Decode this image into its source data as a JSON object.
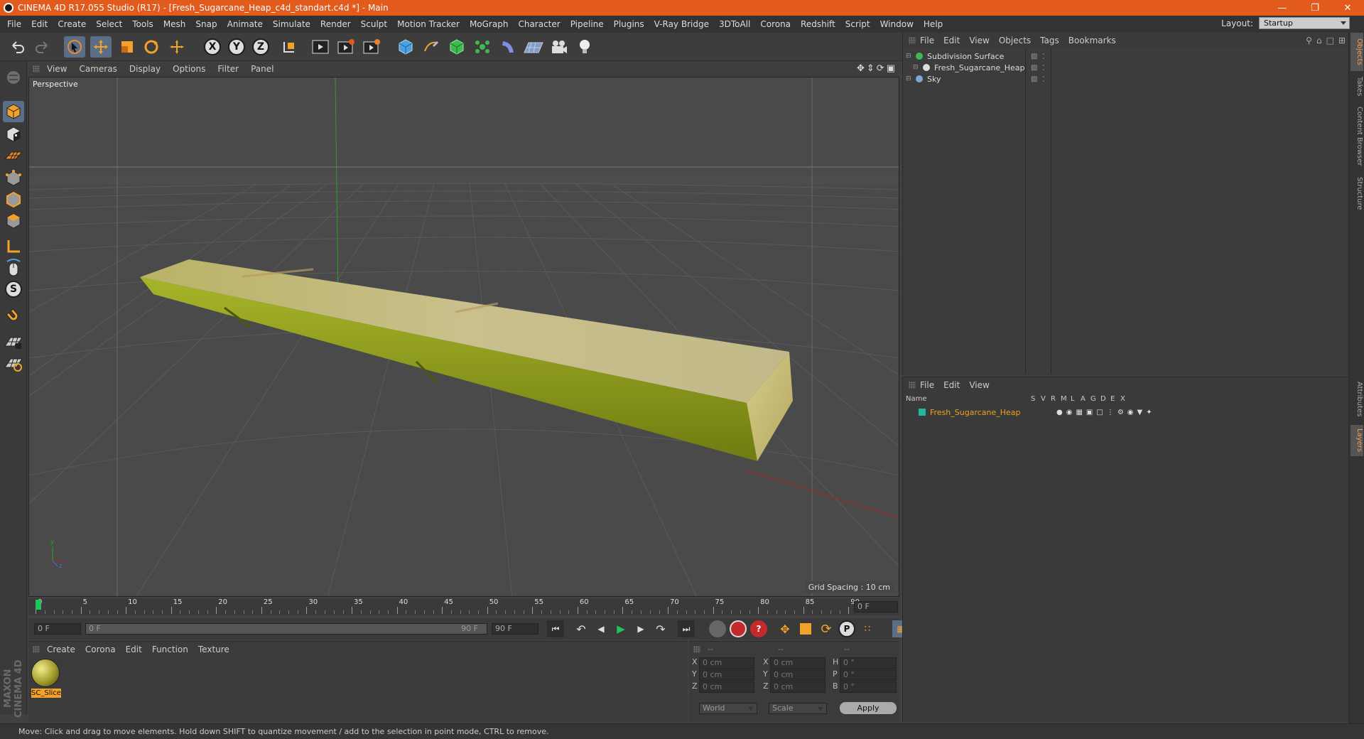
{
  "window": {
    "title": "CINEMA 4D R17.055 Studio (R17) - [Fresh_Sugarcane_Heap_c4d_standart.c4d *] - Main",
    "minimize_icon": "minimize-icon",
    "restore_icon": "restore-icon",
    "close_icon": "close-icon"
  },
  "menubar": {
    "items": [
      "File",
      "Edit",
      "Create",
      "Select",
      "Tools",
      "Mesh",
      "Snap",
      "Animate",
      "Simulate",
      "Render",
      "Sculpt",
      "Motion Tracker",
      "MoGraph",
      "Character",
      "Pipeline",
      "Plugins",
      "V-Ray Bridge",
      "3DToAll",
      "Corona",
      "Redshift",
      "Script",
      "Window",
      "Help"
    ],
    "layout_label": "Layout:",
    "layout_value": "Startup"
  },
  "toolbar": {
    "icons": [
      "undo-icon",
      "redo-icon",
      "select-arrow-icon",
      "move-icon",
      "scale-icon",
      "rotate-icon",
      "last-tool-icon",
      "x-axis-lock-icon",
      "y-axis-lock-icon",
      "z-axis-lock-icon",
      "coordinate-system-icon",
      "render-view-icon",
      "render-picture-viewer-icon",
      "edit-render-settings-icon",
      "cube-object-icon",
      "pen-spline-icon",
      "subdivision-surface-icon",
      "cloner-icon",
      "deformer-icon",
      "floor-icon",
      "camera-icon",
      "light-icon"
    ],
    "axis_labels": [
      "X",
      "Y",
      "Z"
    ]
  },
  "left_toolbar": {
    "icons": [
      "make-editable-icon",
      "model-mode-icon",
      "texture-mode-icon",
      "workplane-icon",
      "points-mode-icon",
      "edges-mode-icon",
      "polygons-mode-icon",
      "axis-mode-icon",
      "tweak-icon",
      "solo-icon",
      "magnet-icon",
      "snap-grid-icon",
      "snap-settings-icon"
    ],
    "solo_letter": "S"
  },
  "viewport": {
    "menu": [
      "View",
      "Cameras",
      "Display",
      "Options",
      "Filter",
      "Panel"
    ],
    "label": "Perspective",
    "grid_spacing": "Grid Spacing : 10 cm",
    "nav_icons": [
      "move-view-icon",
      "dolly-view-icon",
      "rotate-view-icon",
      "maximize-view-icon"
    ],
    "axis_gizmo": {
      "y": "y",
      "z": "z"
    }
  },
  "timeline": {
    "ticks": [
      "0",
      "5",
      "10",
      "15",
      "20",
      "25",
      "30",
      "35",
      "40",
      "45",
      "50",
      "55",
      "60",
      "65",
      "70",
      "75",
      "80",
      "85",
      "90"
    ],
    "current_frame": "0 F",
    "current_position": 0
  },
  "transport": {
    "start_frame": "0 F",
    "range_start": "0 F",
    "range_end": "90 F",
    "end_frame": "90 F",
    "buttons": [
      "go-to-start-icon",
      "previous-key-icon",
      "step-back-icon",
      "play-icon",
      "step-forward-icon",
      "next-key-icon",
      "go-to-end-icon"
    ],
    "record_buttons": [
      "motion-path-icon",
      "record-keys-icon",
      "autokey-icon",
      "key-move-icon",
      "key-scale-icon",
      "key-rotate-icon",
      "key-param-icon",
      "key-pla-icon",
      "timeline-icon"
    ],
    "param_letter": "P"
  },
  "material_manager": {
    "menu": [
      "Create",
      "Corona",
      "Edit",
      "Function",
      "Texture"
    ],
    "materials": [
      {
        "name": "SC_Slice"
      }
    ],
    "brand": "MAXON CINEMA 4D"
  },
  "coordinates": {
    "headers": [
      "--",
      "--",
      "--"
    ],
    "rows": [
      {
        "axis": "X",
        "pos": "0 cm",
        "axis2": "X",
        "size": "0 cm",
        "rot_axis": "H",
        "rot": "0 °"
      },
      {
        "axis": "Y",
        "pos": "0 cm",
        "axis2": "Y",
        "size": "0 cm",
        "rot_axis": "P",
        "rot": "0 °"
      },
      {
        "axis": "Z",
        "pos": "0 cm",
        "axis2": "Z",
        "size": "0 cm",
        "rot_axis": "B",
        "rot": "0 °"
      }
    ],
    "mode": "World",
    "mode2": "Scale",
    "apply": "Apply"
  },
  "object_manager": {
    "menu": [
      "File",
      "Edit",
      "View",
      "Objects",
      "Tags",
      "Bookmarks"
    ],
    "objects": [
      {
        "name": "Subdivision Surface",
        "indent": 0,
        "icon": "subdivision-surface-icon"
      },
      {
        "name": "Fresh_Sugarcane_Heap",
        "indent": 1,
        "icon": "null-object-icon"
      },
      {
        "name": "Sky",
        "indent": 0,
        "icon": "sky-icon"
      }
    ]
  },
  "layer_manager": {
    "menu": [
      "File",
      "Edit",
      "View"
    ],
    "columns": [
      "Name",
      "S",
      "V",
      "R",
      "M",
      "L",
      "A",
      "G",
      "D",
      "E",
      "X"
    ],
    "layers": [
      {
        "name": "Fresh_Sugarcane_Heap",
        "color": "#1fb9a0"
      }
    ]
  },
  "right_tabs": [
    "Objects",
    "Takes",
    "Content Browser",
    "Structure",
    "Attributes",
    "Layers"
  ],
  "statusbar": {
    "text": "Move: Click and drag to move elements. Hold down SHIFT to quantize movement / add to the selection in point mode, CTRL to remove."
  },
  "colors": {
    "accent": "#e25a1c",
    "selected_text": "#f0a020",
    "layer_teal": "#1fb9a0"
  }
}
